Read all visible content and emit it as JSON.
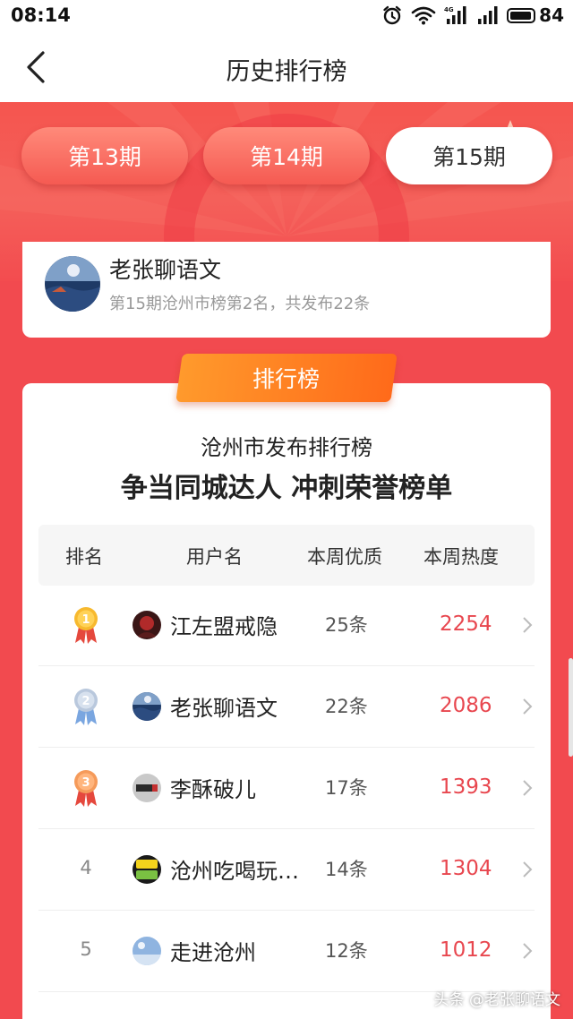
{
  "status_bar": {
    "time": "08:14",
    "battery": "84",
    "network": "4G"
  },
  "nav": {
    "title": "历史排行榜",
    "back_icon": "chevron-left-icon"
  },
  "tabs": [
    {
      "label": "第13期",
      "active": false
    },
    {
      "label": "第14期",
      "active": false
    },
    {
      "label": "第15期",
      "active": true
    }
  ],
  "user_card": {
    "name": "老张聊语文",
    "subtitle": "第15期沧州市榜第2名，共发布22条"
  },
  "ranking": {
    "badge": "排行榜",
    "title": "沧州市发布排行榜",
    "slogan": "争当同城达人 冲刺荣誉榜单",
    "headers": {
      "rank": "排名",
      "user": "用户名",
      "quality": "本周优质",
      "heat": "本周热度"
    },
    "rows": [
      {
        "rank": "1",
        "name": "江左盟戒隐",
        "count": "25条",
        "heat": "2254",
        "medal": "gold"
      },
      {
        "rank": "2",
        "name": "老张聊语文",
        "count": "22条",
        "heat": "2086",
        "medal": "silver"
      },
      {
        "rank": "3",
        "name": "李酥破儿",
        "count": "17条",
        "heat": "1393",
        "medal": "bronze"
      },
      {
        "rank": "4",
        "name": "沧州吃喝玩…",
        "count": "14条",
        "heat": "1304",
        "medal": ""
      },
      {
        "rank": "5",
        "name": "走进沧州",
        "count": "12条",
        "heat": "1012",
        "medal": ""
      }
    ]
  },
  "watermark": "头条 @老张聊语文",
  "colors": {
    "accent": "#f24a4f",
    "heat": "#e8474f",
    "badge": "#ff7a22"
  }
}
